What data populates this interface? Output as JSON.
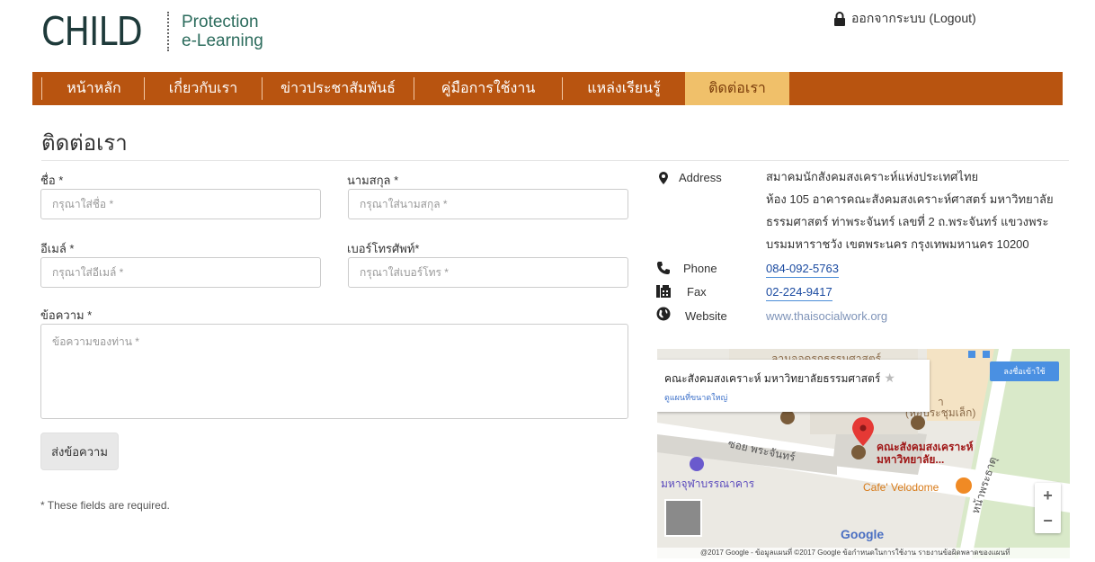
{
  "header": {
    "logo_main": "CHILD",
    "logo_line1": "Protection",
    "logo_line2": "e-Learning",
    "logout": "ออกจากระบบ (Logout)"
  },
  "nav": {
    "items": [
      {
        "label": "หน้าหลัก"
      },
      {
        "label": "เกี่ยวกับเรา"
      },
      {
        "label": "ข่าวประชาสัมพันธ์"
      },
      {
        "label": "คู่มือการใช้งาน"
      },
      {
        "label": "แหล่งเรียนรู้"
      },
      {
        "label": "ติดต่อเรา",
        "active": true
      }
    ]
  },
  "page": {
    "title": "ติดต่อเรา"
  },
  "form": {
    "first_name_label": "ชื่อ *",
    "first_name_placeholder": "กรุณาใส่ชื่อ *",
    "last_name_label": "นามสกุล *",
    "last_name_placeholder": "กรุณาใส่นามสกุล *",
    "email_label": "อีเมล์ *",
    "email_placeholder": "กรุณาใส่อีเมล์ *",
    "phone_label": "เบอร์โทรศัพท์*",
    "phone_placeholder": "กรุณาใส่เบอร์โทร *",
    "message_label": "ข้อความ *",
    "message_placeholder": "ข้อความของท่าน *",
    "submit_label": "ส่งข้อความ",
    "required_note": "* These fields are required."
  },
  "contact": {
    "address_label": "Address",
    "address_lines": [
      "สมาคมนักสังคมสงเคราะห์แห่งประเทศไทย",
      "ห้อง 105 อาคารคณะสังคมสงเคราะห์ศาสตร์ มหาวิทยาลัย",
      "ธรรมศาสตร์ ท่าพระจันทร์ เลขที่ 2 ถ.พระจันทร์ แขวงพระ",
      "บรมมหาราชวัง เขตพระนคร กรุงเทพมหานคร 10200"
    ],
    "phone_label": "Phone",
    "phone_value": "084-092-5763",
    "fax_label": "Fax",
    "fax_value": "02-224-9417",
    "website_label": "Website",
    "website_value": "www.thaisocialwork.org"
  },
  "map": {
    "place_title": "คณะสังคมสงเคราะห์ มหาวิทยาลัยธรรมศาสตร์",
    "larger_map_link": "ดูแผนที่ขนาดใหญ่",
    "sign_in": "ลงชื่อเข้าใช้",
    "zoom_in": "+",
    "zoom_out": "−",
    "label_parking": "ลานจอดรถธรรมศาสตร์",
    "label_pin": "คณะสังคมสงเคราะห์",
    "label_pin2": "มหาวิทยาลัย...",
    "label_road": "ซอย พระจันทร์",
    "label_road2": "หน้าพระธาตุ",
    "label_mall": "มหาจุฬาบรรณาคาร",
    "label_cafe": "Cafe' Velodome",
    "label_hall": "(หอประชุมเล็ก)",
    "label_hall_partial": "า",
    "google": "Google",
    "footer": "@2017 Google - ข้อมูลแผนที่ ©2017 Google   ข้อกำหนดในการใช้งาน   รายงานข้อผิดพลาดของแผนที่",
    "pin_color": "#e53935"
  }
}
